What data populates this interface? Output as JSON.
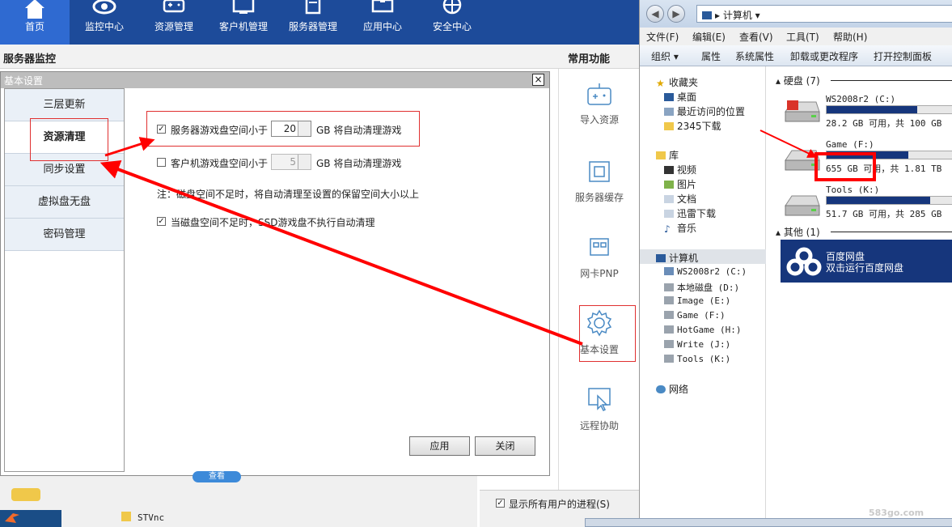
{
  "nav": {
    "items": [
      {
        "label": "首页",
        "icon": "home-icon",
        "active": true
      },
      {
        "label": "监控中心",
        "icon": "eye-icon"
      },
      {
        "label": "资源管理",
        "icon": "gamepad-icon"
      },
      {
        "label": "客户机管理",
        "icon": "monitor-icon"
      },
      {
        "label": "服务器管理",
        "icon": "server-icon"
      },
      {
        "label": "应用中心",
        "icon": "box-icon"
      },
      {
        "label": "安全中心",
        "icon": "shield-icon"
      }
    ]
  },
  "monitor": {
    "title": "服务器监控"
  },
  "common": {
    "title": "常用功能",
    "items": [
      {
        "label": "导入资源",
        "icon": "gamepad-icon"
      },
      {
        "label": "服务器缓存",
        "icon": "chip-icon"
      },
      {
        "label": "网卡PNP",
        "icon": "network-card-icon"
      },
      {
        "label": "基本设置",
        "icon": "gear-icon"
      },
      {
        "label": "远程协助",
        "icon": "remote-icon"
      }
    ]
  },
  "dialog": {
    "title": "基本设置",
    "close": "×",
    "sidebar": [
      "三层更新",
      "资源清理",
      "同步设置",
      "虚拟盘无盘",
      "密码管理"
    ],
    "selected": "资源清理",
    "options": {
      "server_label": "服务器游戏盘空间小于",
      "server_value": "20",
      "server_suffix": "GB 将自动清理游戏",
      "client_label": "客户机游戏盘空间小于",
      "client_value": "5",
      "client_suffix": "GB 将自动清理游戏",
      "note": "注：磁盘空间不足时，将自动清理至设置的保留空间大小以上",
      "ssd_label": "当磁盘空间不足时，SSD游戏盘不执行自动清理"
    },
    "apply": "应用",
    "close_btn": "关闭"
  },
  "explorer": {
    "address": "计算机",
    "menu": [
      "文件(F)",
      "编辑(E)",
      "查看(V)",
      "工具(T)",
      "帮助(H)"
    ],
    "toolbar": [
      "组织",
      "属性",
      "系统属性",
      "卸载或更改程序",
      "打开控制面板"
    ],
    "tree": {
      "favorites": "收藏夹",
      "fav_items": [
        "桌面",
        "最近访问的位置",
        "2345下载"
      ],
      "library": "库",
      "lib_items": [
        "视频",
        "图片",
        "文档",
        "迅雷下载",
        "音乐"
      ],
      "computer": "计算机",
      "drives": [
        "WS2008r2 (C:)",
        "本地磁盘 (D:)",
        "Image (E:)",
        "Game (F:)",
        "HotGame (H:)",
        "Write (J:)",
        "Tools (K:)"
      ],
      "network": "网络"
    },
    "content": {
      "disk_group": "硬盘 (7)",
      "drives": [
        {
          "name": "WS2008r2 (C:)",
          "info": "28.2 GB 可用，共 100 GB",
          "used": 0.72
        },
        {
          "name": "Game (F:)",
          "free": "655 GB 可用",
          "total": "，共 1.81 TB",
          "used": 0.65
        },
        {
          "name": "Tools (K:)",
          "info": "51.7 GB 可用，共 285 GB",
          "used": 0.82
        }
      ],
      "other_group": "其他 (1)",
      "baidu_name": "百度网盘",
      "baidu_desc": "双击运行百度网盘"
    }
  },
  "bottom": {
    "folder": "STVnc",
    "show_all": "显示所有用户的进程(S)",
    "view_btn": "查看",
    "watermark": "583go.com"
  }
}
